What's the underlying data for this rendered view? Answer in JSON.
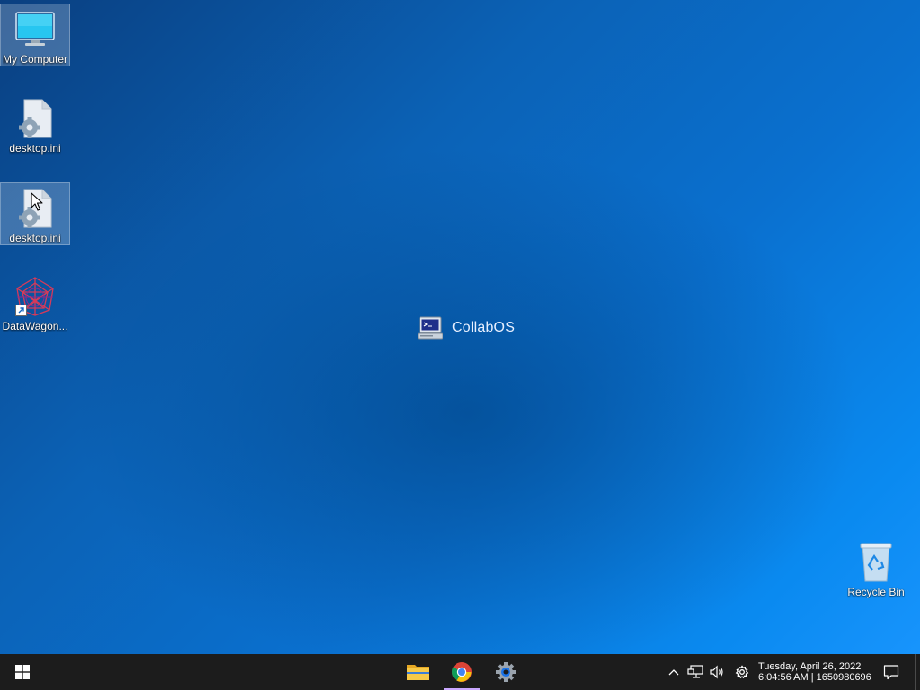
{
  "desktop": {
    "icons": [
      {
        "label": "My Computer",
        "icon": "monitor-icon",
        "selected": true
      },
      {
        "label": "desktop.ini",
        "icon": "settings-file-icon",
        "selected": false
      },
      {
        "label": "desktop.ini",
        "icon": "settings-file-icon",
        "selected": true
      },
      {
        "label": "DataWagon...",
        "icon": "datawagon-logo-icon",
        "shortcut": true,
        "selected": false
      },
      {
        "label": "Recycle Bin",
        "icon": "recycle-bin-icon",
        "selected": false
      }
    ],
    "center_brand": {
      "text": "CollabOS",
      "icon": "collabos-terminal-icon"
    }
  },
  "taskbar": {
    "start_icon": "windows-start-icon",
    "apps": [
      {
        "name": "File Explorer",
        "icon": "folder-icon",
        "running": false
      },
      {
        "name": "Google Chrome",
        "icon": "chrome-icon",
        "running": true
      },
      {
        "name": "Settings",
        "icon": "settings-gear-icon",
        "running": false
      }
    ],
    "tray": {
      "overflow_icon": "chevron-up-icon",
      "network_icon": "network-icon",
      "volume_icon": "speaker-icon",
      "settings_icon": "gear-icon",
      "clock": {
        "date": "Tuesday, April 26, 2022",
        "time": "6:04:56 AM | 1650980696"
      },
      "notifications_icon": "notification-icon"
    }
  },
  "colors": {
    "taskbar_bg": "#1c1c1c",
    "running_indicator": "#c9a7ff",
    "wallpaper_primary": "#0a6ecd"
  }
}
